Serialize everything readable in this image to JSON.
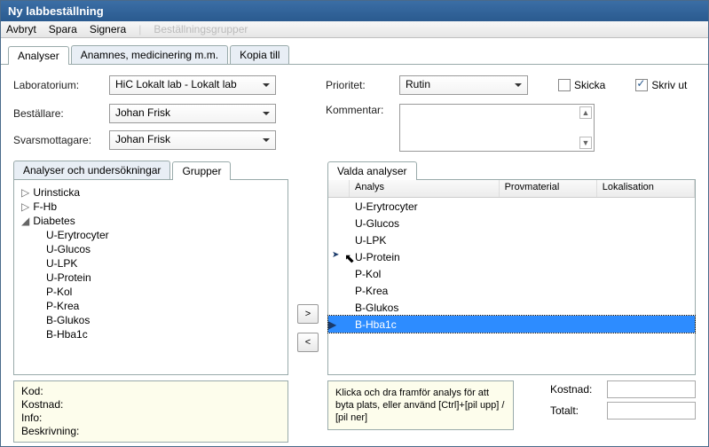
{
  "title": "Ny labbeställning",
  "menu": {
    "avbryt": "Avbryt",
    "spara": "Spara",
    "signera": "Signera",
    "bestallningsgrupper": "Beställningsgrupper"
  },
  "mainTabs": {
    "analyser": "Analyser",
    "anamnes": "Anamnes, medicinering m.m.",
    "kopia": "Kopia till"
  },
  "fields": {
    "laboratorium_label": "Laboratorium:",
    "laboratorium_value": "HiC Lokalt lab - Lokalt lab",
    "bestallare_label": "Beställare:",
    "bestallare_value": "Johan Frisk",
    "svarsmottagare_label": "Svarsmottagare:",
    "svarsmottagare_value": "Johan Frisk",
    "prioritet_label": "Prioritet:",
    "prioritet_value": "Rutin",
    "kommentar_label": "Kommentar:",
    "skicka_label": "Skicka",
    "skrivut_label": "Skriv ut"
  },
  "subTabs": {
    "analyser": "Analyser och undersökningar",
    "grupper": "Grupper"
  },
  "tree": {
    "items": [
      {
        "label": "Urinsticka",
        "expanded": false
      },
      {
        "label": "F-Hb",
        "expanded": false
      },
      {
        "label": "Diabetes",
        "expanded": true
      }
    ],
    "children": [
      "U-Erytrocyter",
      "U-Glucos",
      "U-LPK",
      "U-Protein",
      "P-Kol",
      "P-Krea",
      "B-Glukos",
      "B-Hba1c"
    ]
  },
  "infoLabels": {
    "kod": "Kod:",
    "kostnad": "Kostnad:",
    "info": "Info:",
    "beskrivning": "Beskrivning:"
  },
  "arrows": {
    "right": ">",
    "left": "<"
  },
  "valdaTab": "Valda analyser",
  "gridHeaders": {
    "analys": "Analys",
    "provmaterial": "Provmaterial",
    "lokalisation": "Lokalisation"
  },
  "gridRows": [
    "U-Erytrocyter",
    "U-Glucos",
    "U-LPK",
    "U-Protein",
    "P-Kol",
    "P-Krea",
    "B-Glukos",
    "B-Hba1c"
  ],
  "hint": "Klicka och dra framför analys för att byta plats, eller använd [Ctrl]+[pil upp] / [pil ner]",
  "costLabels": {
    "kostnad": "Kostnad:",
    "totalt": "Totalt:"
  }
}
